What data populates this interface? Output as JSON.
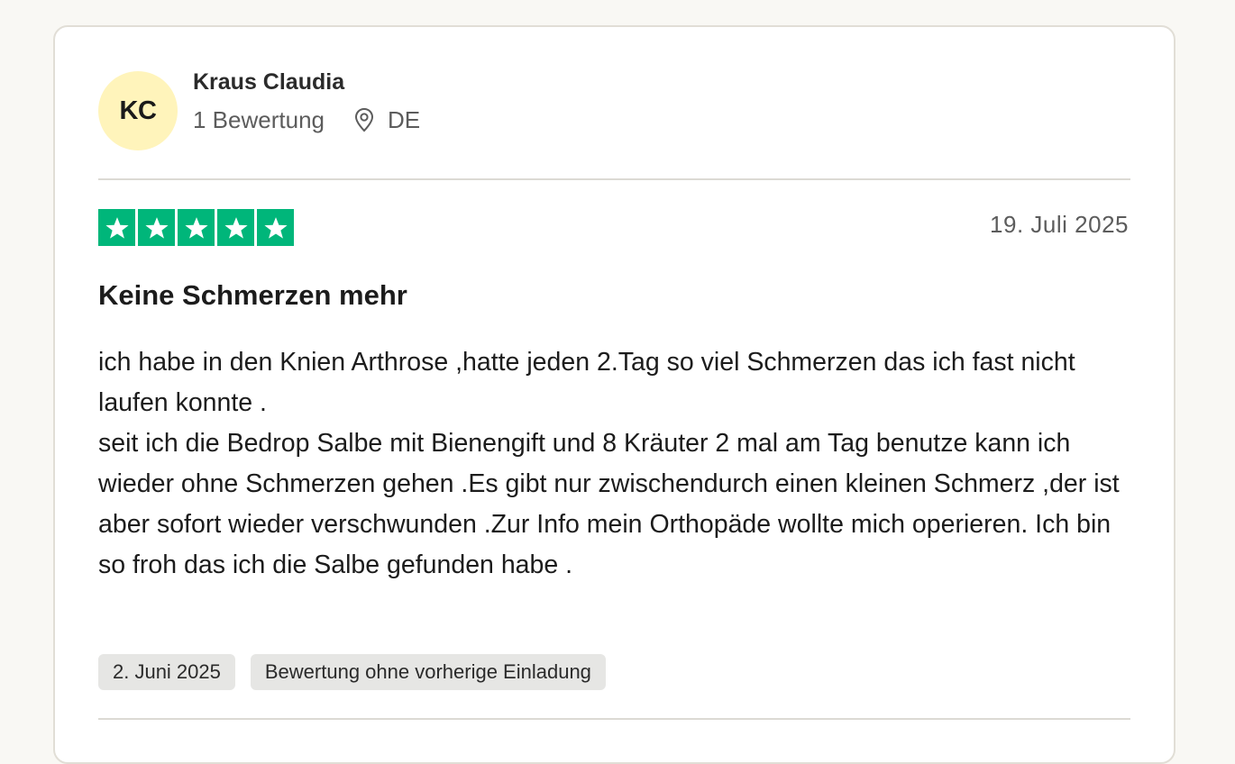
{
  "consumer": {
    "initials": "KC",
    "name": "Kraus Claudia",
    "reviews_count": "1 Bewertung",
    "country": "DE"
  },
  "review": {
    "rating": 5,
    "rating_max": 5,
    "date": "19. Juli 2025",
    "title": "Keine Schmerzen mehr",
    "text": "ich habe in den Knien Arthrose ,hatte jeden 2.Tag so viel Schmerzen das ich fast nicht laufen konnte .\nseit ich die Bedrop Salbe mit Bienengift und 8 Kräuter 2 mal am Tag benutze kann ich wieder ohne Schmerzen gehen .Es gibt nur zwischendurch einen kleinen Schmerz ,der ist aber sofort wieder verschwunden .Zur Info mein Orthopäde wollte mich operieren. Ich bin so froh das ich die Salbe gefunden habe .",
    "experience_date": "2. Juni 2025",
    "invitation_label": "Bewertung ohne vorherige Einladung"
  },
  "colors": {
    "star_green": "#00b67a",
    "avatar_bg": "#fff4bb",
    "page_bg": "#f9f8f4",
    "tag_bg": "#e6e6e4"
  },
  "icons": {
    "location": "map-pin-icon",
    "star": "star-icon"
  }
}
